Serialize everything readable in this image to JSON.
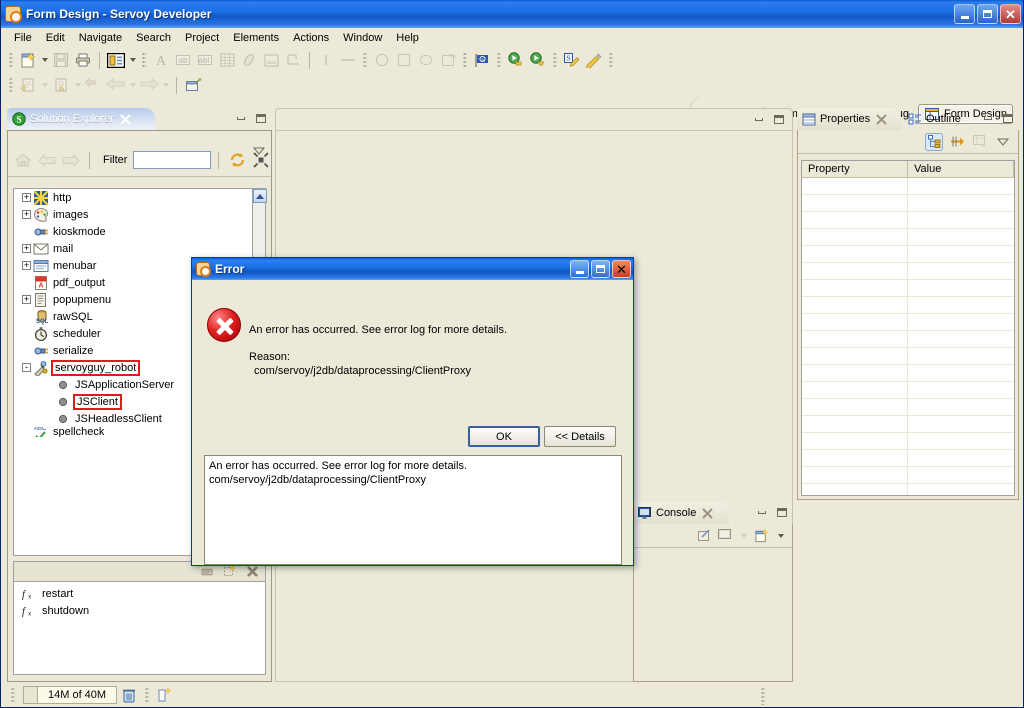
{
  "window": {
    "title": "Form Design - Servoy Developer",
    "icon": "servoy-app-icon",
    "buttons": {
      "minimize": "_",
      "maximize": "□",
      "close": "✕"
    }
  },
  "menubar": {
    "items": [
      "File",
      "Edit",
      "Navigate",
      "Search",
      "Project",
      "Elements",
      "Actions",
      "Window",
      "Help"
    ]
  },
  "toolbar": {
    "row1": [
      {
        "name": "new-wizard-button",
        "icon": "new-file-icon",
        "dropdown": true
      },
      {
        "name": "save-button",
        "icon": "save-disk-icon",
        "disabled": true
      },
      {
        "name": "print-button",
        "icon": "printer-icon"
      },
      {
        "name": "layout-button",
        "icon": "form-layout-icon",
        "dropdown": true
      },
      {
        "name": "text-label-button",
        "icon": "letter-a-icon",
        "disabled": true
      },
      {
        "name": "text-field-button",
        "icon": "ab-field-icon",
        "disabled": true
      },
      {
        "name": "text-area-button",
        "icon": "abl-field-icon",
        "disabled": true
      },
      {
        "name": "portal-button",
        "icon": "table-grid-icon",
        "disabled": true
      },
      {
        "name": "tabpanel-button",
        "icon": "tab-panel-icon",
        "disabled": true
      },
      {
        "name": "image-button",
        "icon": "picture-icon",
        "disabled": true
      },
      {
        "name": "shape-button",
        "icon": "corner-shape-icon",
        "disabled": true
      },
      {
        "name": "vertical-line-button",
        "icon": "vertical-line-icon",
        "disabled": true
      },
      {
        "name": "horizontal-line-button",
        "icon": "horizontal-line-icon",
        "disabled": true
      },
      {
        "name": "ellipse-button",
        "icon": "circle-icon",
        "disabled": true
      },
      {
        "name": "rectangle-button",
        "icon": "square-icon",
        "disabled": true
      },
      {
        "name": "rounded-rect-button",
        "icon": "rounded-rect-icon",
        "disabled": true
      },
      {
        "name": "3d-box-button",
        "icon": "box-3d-icon",
        "disabled": true
      },
      {
        "name": "i18n-button",
        "icon": "flag-icon"
      },
      {
        "name": "run-button",
        "icon": "run-green-icon"
      },
      {
        "name": "run-web-button",
        "icon": "run-web-green-icon"
      },
      {
        "name": "smart-client-button",
        "icon": "smart-client-icon"
      },
      {
        "name": "web-client-button",
        "icon": "web-client-icon"
      }
    ],
    "row2": [
      {
        "name": "export-button",
        "icon": "export-icon",
        "dropdown": true,
        "disabled": true
      },
      {
        "name": "import-button",
        "icon": "import-icon",
        "dropdown": true,
        "disabled": true
      },
      {
        "name": "back-history-button",
        "icon": "back-arrow-icon",
        "disabled": true
      },
      {
        "name": "previous-button",
        "icon": "left-arrow-icon",
        "dropdown": true,
        "disabled": true
      },
      {
        "name": "next-button",
        "icon": "right-arrow-icon",
        "dropdown": true,
        "disabled": true
      },
      {
        "name": "open-editor-button",
        "icon": "open-editor-icon"
      }
    ]
  },
  "perspective": {
    "new_perspective_label": "",
    "items": [
      {
        "name": "open-perspective-button",
        "icon": "open-perspective-icon",
        "label": ""
      },
      {
        "name": "team-synchronizing-perspective",
        "icon": "team-sync-icon",
        "label": "Team Synchr..."
      },
      {
        "name": "debug-perspective",
        "icon": "debug-bug-icon",
        "label": "Debug"
      },
      {
        "name": "form-design-perspective",
        "icon": "form-design-icon",
        "label": "Form Design",
        "active": true
      }
    ]
  },
  "solution_explorer": {
    "tab_label": "Solution Explorer",
    "tab_icon": "servoy-solution-icon",
    "close_icon": "close-x-icon",
    "minimize_icon": "minimize-icon",
    "maximize_icon": "maximize-icon",
    "view_menu_icon": "view-menu-chevron-icon",
    "nav": {
      "home_icon": "home-icon",
      "back_icon": "back-arrow-icon",
      "forward_icon": "forward-arrow-icon",
      "filter_label": "Filter",
      "filter_value": "",
      "filter_placeholder": "",
      "refresh_icon": "refresh-cycle-icon",
      "collapse_icon": "collapse-all-icon",
      "link_icon": "link-with-editor-icon"
    },
    "tree": [
      {
        "label": "http",
        "icon": "http-icon",
        "twisty": "+",
        "indent": 0
      },
      {
        "label": "images",
        "icon": "images-palette-icon",
        "twisty": "+",
        "indent": 0
      },
      {
        "label": "kioskmode",
        "icon": "kioskmode-plug-icon",
        "twisty": "",
        "indent": 0
      },
      {
        "label": "mail",
        "icon": "mail-envelope-icon",
        "twisty": "+",
        "indent": 0
      },
      {
        "label": "menubar",
        "icon": "menubar-icon",
        "twisty": "+",
        "indent": 0
      },
      {
        "label": "pdf_output",
        "icon": "pdf-icon",
        "twisty": "",
        "indent": 0
      },
      {
        "label": "popupmenu",
        "icon": "popupmenu-icon",
        "twisty": "+",
        "indent": 0
      },
      {
        "label": "rawSQL",
        "icon": "sql-db-icon",
        "twisty": "",
        "indent": 0
      },
      {
        "label": "scheduler",
        "icon": "scheduler-clock-icon",
        "twisty": "",
        "indent": 0
      },
      {
        "label": "serialize",
        "icon": "serialize-plug-icon",
        "twisty": "",
        "indent": 0
      },
      {
        "label": "servoyguy_robot",
        "icon": "robot-plugin-icon",
        "twisty": "-",
        "indent": 0,
        "highlight": true
      },
      {
        "label": "JSApplicationServer",
        "icon": "bullet-gray-icon",
        "twisty": "",
        "indent": 1
      },
      {
        "label": "JSClient",
        "icon": "bullet-gray-icon",
        "twisty": "",
        "indent": 1,
        "highlight": true
      },
      {
        "label": "JSHeadlessClient",
        "icon": "bullet-gray-icon",
        "twisty": "",
        "indent": 1
      },
      {
        "label": "spellcheck",
        "icon": "spellcheck-abc-icon",
        "twisty": "",
        "indent": 0,
        "clipped": true
      }
    ],
    "list_toolbar": {
      "move_icon": "move-code-icon",
      "new-icon": "new-item-icon",
      "delete_icon": "delete-x-icon"
    },
    "members": [
      {
        "label": "restart",
        "icon": "function-fx-icon"
      },
      {
        "label": "shutdown",
        "icon": "function-fx-icon"
      }
    ]
  },
  "editor": {
    "minimize_icon": "minimize-icon",
    "maximize_icon": "maximize-icon",
    "canvas_empty": true
  },
  "properties": {
    "tabs": [
      {
        "label": "Properties",
        "icon": "properties-table-icon",
        "active": true,
        "closeable": true
      },
      {
        "label": "Outline",
        "icon": "outline-tree-icon",
        "active": false,
        "closeable": false
      }
    ],
    "close_icon": "close-x-icon",
    "minimize_icon": "minimize-icon",
    "maximize_icon": "maximize-icon",
    "toolbar": [
      {
        "name": "show-categories-button",
        "icon": "categories-tree-icon",
        "selected": true
      },
      {
        "name": "show-advanced-button",
        "icon": "advanced-filter-icon",
        "selected": false
      },
      {
        "name": "restore-default-button",
        "icon": "restore-default-icon",
        "selected": false,
        "disabled": true
      },
      {
        "name": "view-menu-button",
        "icon": "view-menu-chevron-icon",
        "selected": false
      }
    ],
    "columns": [
      "Property",
      "Value"
    ],
    "rows": []
  },
  "console": {
    "tab_label": "Console",
    "tab_icon": "console-monitor-icon",
    "close_icon": "close-x-icon",
    "minimize_icon": "minimize-icon",
    "maximize_icon": "maximize-icon",
    "toolbar": [
      {
        "name": "clear-console-button",
        "icon": "clear-console-icon"
      },
      {
        "name": "display-console-button",
        "icon": "display-console-icon",
        "dropdown": true
      },
      {
        "name": "open-console-button",
        "icon": "open-console-icon",
        "dropdown": true
      }
    ]
  },
  "statusbar": {
    "heap_text": "14M of 40M",
    "trash_icon": "trash-can-icon",
    "misc_icon": "column-move-icon"
  },
  "error_dialog": {
    "title": "Error",
    "title_icon": "servoy-app-icon",
    "buttons": {
      "minimize": "_",
      "maximize": "□",
      "close": "✕"
    },
    "severity_icon": "error-cross-icon",
    "message": "An error has occurred. See error log for more details.",
    "reason_label": "Reason:",
    "reason_text": "com/servoy/j2db/dataprocessing/ClientProxy",
    "ok_label": "OK",
    "details_label": "<< Details",
    "details_text": "An error has occurred. See error log for more details.\ncom/servoy/j2db/dataprocessing/ClientProxy"
  },
  "colors": {
    "titlebar_blue": "#1a6be0",
    "chrome_beige": "#ece9d8",
    "highlight_red": "#e01b1b",
    "error_red": "#e02020",
    "tab_active_blue": "#b7cbe8"
  }
}
